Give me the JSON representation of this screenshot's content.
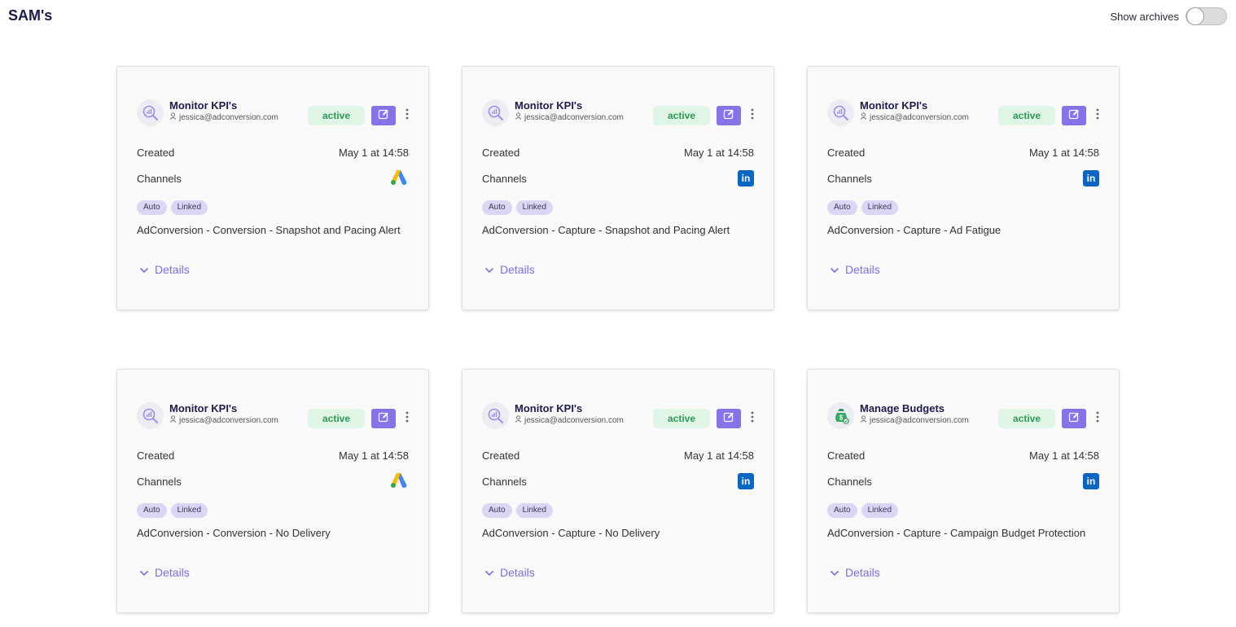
{
  "header": {
    "title": "SAM's",
    "archives_label": "Show archives",
    "archives_on": false
  },
  "labels": {
    "created": "Created",
    "channels": "Channels",
    "details": "Details"
  },
  "colors": {
    "accent": "#8474e8",
    "status_bg": "#dff6e6",
    "status_text": "#2e9a54",
    "tag_bg": "#dad6f4"
  },
  "cards": [
    {
      "name": "Monitor KPI's",
      "owner": "jessica@adconversion.com",
      "status": "active",
      "icon": "kpi-search-icon",
      "created": "May 1 at 14:58",
      "channel": "google-ads",
      "tags": [
        "Auto",
        "Linked"
      ],
      "description": "AdConversion - Conversion - Snapshot and Pacing Alert"
    },
    {
      "name": "Monitor KPI's",
      "owner": "jessica@adconversion.com",
      "status": "active",
      "icon": "kpi-search-icon",
      "created": "May 1 at 14:58",
      "channel": "linkedin",
      "tags": [
        "Auto",
        "Linked"
      ],
      "description": "AdConversion - Capture - Snapshot and Pacing Alert"
    },
    {
      "name": "Monitor KPI's",
      "owner": "jessica@adconversion.com",
      "status": "active",
      "icon": "kpi-search-icon",
      "created": "May 1 at 14:58",
      "channel": "linkedin",
      "tags": [
        "Auto",
        "Linked"
      ],
      "description": "AdConversion - Capture - Ad Fatigue"
    },
    {
      "name": "Monitor KPI's",
      "owner": "jessica@adconversion.com",
      "status": "active",
      "icon": "kpi-search-icon",
      "created": "May 1 at 14:58",
      "channel": "google-ads",
      "tags": [
        "Auto",
        "Linked"
      ],
      "description": "AdConversion - Conversion - No Delivery"
    },
    {
      "name": "Monitor KPI's",
      "owner": "jessica@adconversion.com",
      "status": "active",
      "icon": "kpi-search-icon",
      "created": "May 1 at 14:58",
      "channel": "linkedin",
      "tags": [
        "Auto",
        "Linked"
      ],
      "description": "AdConversion - Capture - No Delivery"
    },
    {
      "name": "Manage Budgets",
      "owner": "jessica@adconversion.com",
      "status": "active",
      "icon": "money-bag-icon",
      "created": "May 1 at 14:58",
      "channel": "linkedin",
      "tags": [
        "Auto",
        "Linked"
      ],
      "description": "AdConversion - Capture - Campaign Budget Protection"
    }
  ]
}
